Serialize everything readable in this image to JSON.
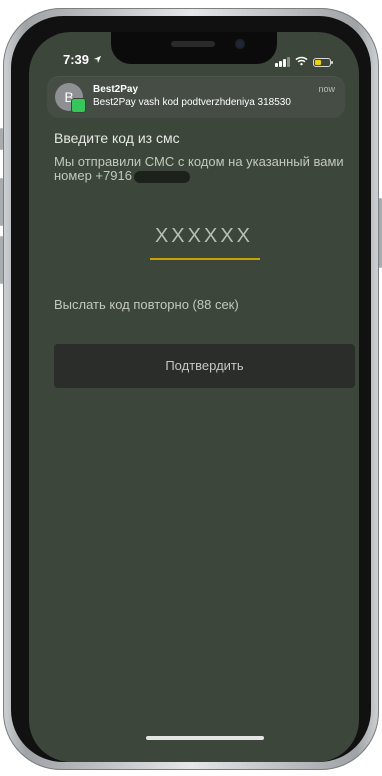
{
  "status_bar": {
    "time": "7:39"
  },
  "notification": {
    "avatar_letter": "B",
    "app_name": "Best2Pay",
    "message": "Best2Pay vash kod podtverzhdeniya 318530",
    "time": "now"
  },
  "sms_form": {
    "heading": "Введите код из смс",
    "description": "Мы отправили СМС с кодом на указанный вами номер +7916",
    "code_placeholder": "XXXXXX",
    "resend_label": "Выслать код повторно (88 сек)",
    "confirm_label": "Подтвердить"
  },
  "colors": {
    "screen_background": "#3c463a",
    "accent_underline": "#c9a300",
    "button_background": "#2a2d29"
  }
}
